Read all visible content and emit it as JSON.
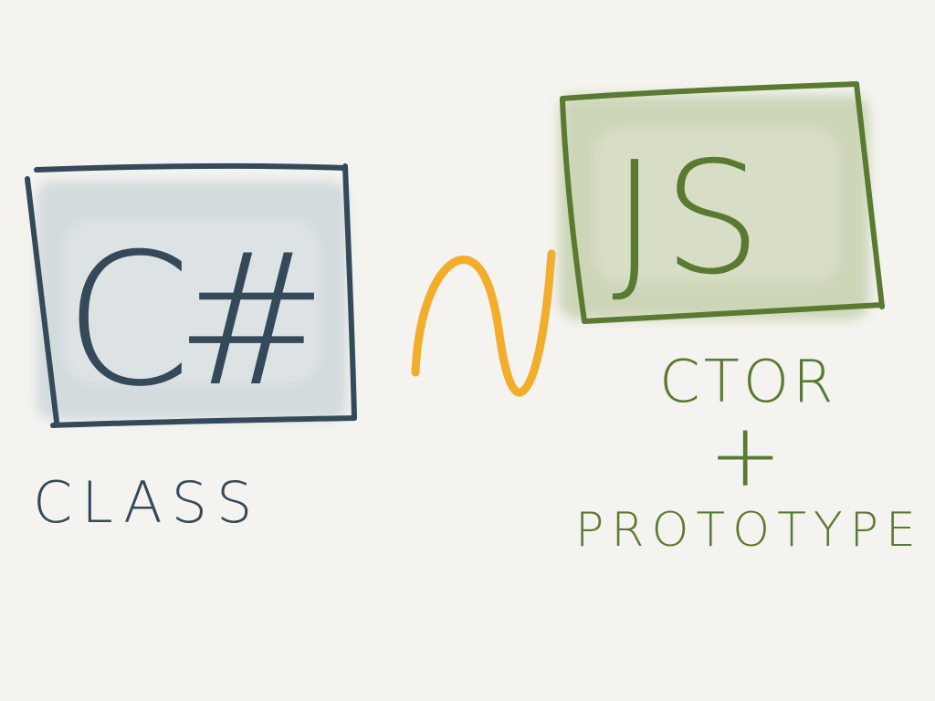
{
  "left_box": {
    "symbol": "C#",
    "label": "CLASS",
    "stroke_color": "#34495a",
    "fill_color": "#c9d3d8"
  },
  "connector": {
    "symbol": "∼",
    "meaning": "approximately-equals",
    "color": "#f2ad2a"
  },
  "right_box": {
    "symbol": "JS",
    "label_line_1": "CTOR",
    "label_line_2": "+",
    "label_line_3": "PROTOTYPE",
    "stroke_color": "#5a7a32",
    "fill_color": "#c3cfaa"
  },
  "background_color": "#f4f3ef"
}
